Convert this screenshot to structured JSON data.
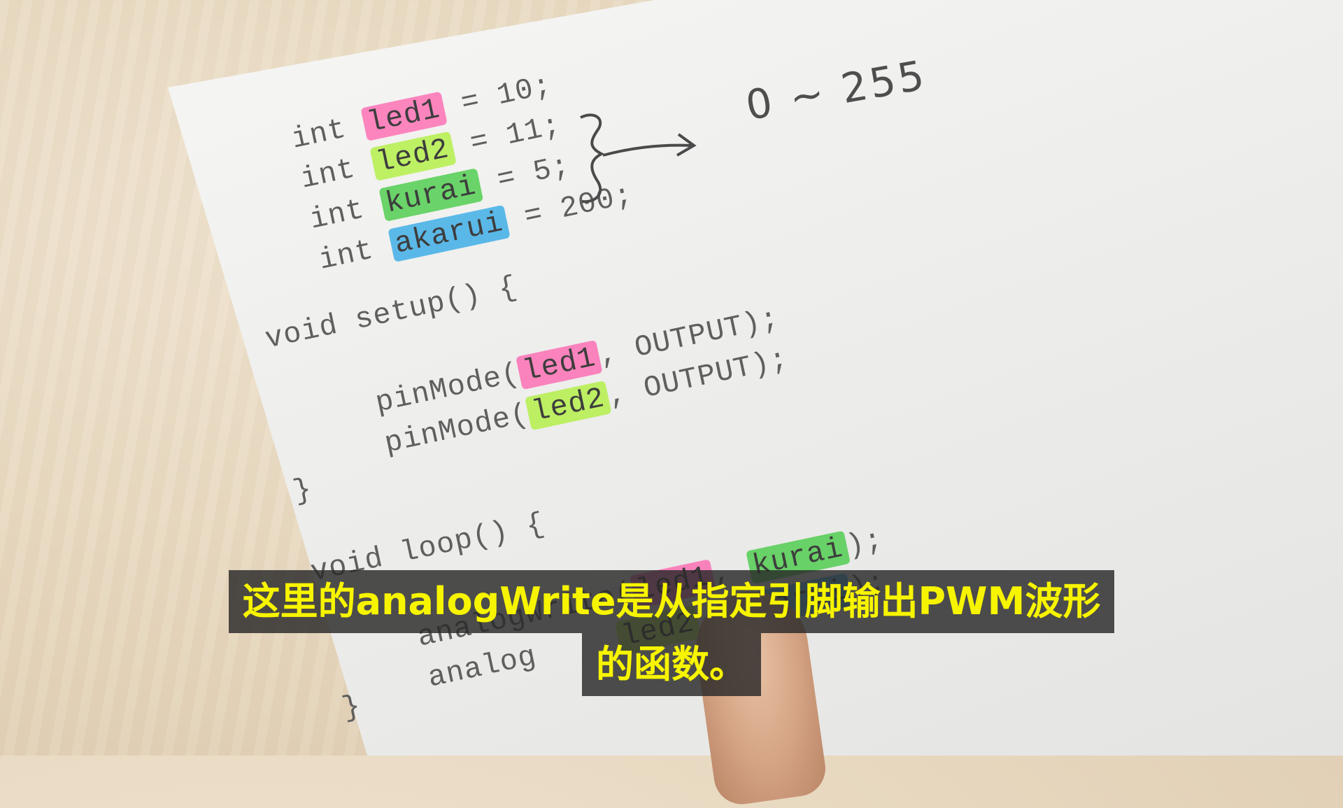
{
  "declarations": [
    {
      "type": "int",
      "name": "led1",
      "rest": "= 10;",
      "color": "#ff5aaa"
    },
    {
      "type": "int",
      "name": "led2",
      "rest": "= 11;",
      "color": "#aff03c"
    },
    {
      "type": "int",
      "name": "kurai",
      "rest": "= 5;",
      "color": "#3cc83c"
    },
    {
      "type": "int",
      "name": "akarui",
      "rest": "= 200;",
      "color": "#28a5e6"
    }
  ],
  "annotation": {
    "text": "0 ~ 255"
  },
  "setup": {
    "signature": "void setup() {",
    "line1_call": "pinMode(",
    "line1_arg": "led1",
    "line1_rest": ", OUTPUT);",
    "line2_call": "pinMode(",
    "line2_arg": "led2",
    "line2_rest": ", OUTPUT);",
    "close": "}"
  },
  "loop": {
    "signature": "void loop() {",
    "line1_call": "analogWrite(",
    "line1_arg1": "led1",
    "line1_sep": ", ",
    "line1_arg2": "kurai",
    "line1_rest": ");",
    "line2_call": "analog",
    "line2_arg1": "led2",
    "line2_sep": ", ",
    "line2_arg2": "akarui",
    "line2_rest": ");",
    "close": "}"
  },
  "subtitle": {
    "line1": "这里的analogWrite是从指定引脚输出PWM波形",
    "line2": "的函数。",
    "text_color": "#f7f400"
  }
}
